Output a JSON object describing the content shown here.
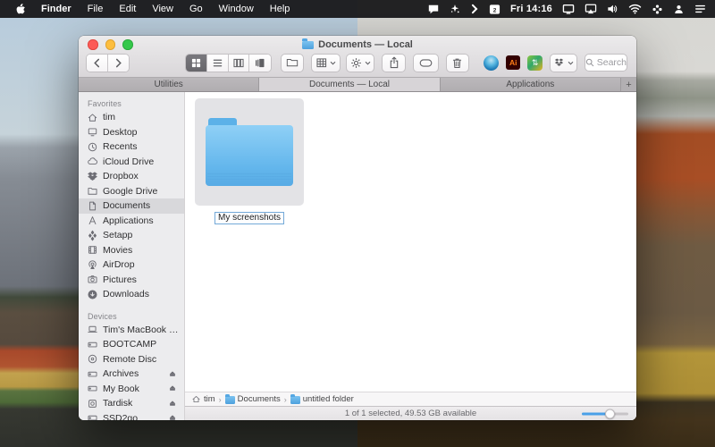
{
  "menu_bar": {
    "apple_logo": "apple",
    "items": [
      "Finder",
      "File",
      "Edit",
      "View",
      "Go",
      "Window",
      "Help"
    ],
    "clock": "Fri 14:16",
    "calendar_day": "2",
    "status_icons": [
      "chat",
      "wand",
      "chevron",
      "calendar",
      "display",
      "airplay",
      "volume",
      "wifi",
      "fan",
      "user",
      "list"
    ]
  },
  "window": {
    "title": "Documents — Local",
    "tabs": [
      {
        "label": "Utilities",
        "active": false
      },
      {
        "label": "Documents — Local",
        "active": true
      },
      {
        "label": "Applications",
        "active": false
      }
    ],
    "add_tab_label": "+",
    "search_placeholder": "Search",
    "toolbar_icons": [
      "back",
      "forward",
      "icon-view",
      "list-view",
      "column-view",
      "coverflow-view",
      "new-folder",
      "arrange-menu",
      "action-menu",
      "share",
      "tag",
      "trash",
      "app-sphere",
      "app-illustrator",
      "app-colored",
      "dropbox-menu",
      "search"
    ],
    "ai_label": "Ai"
  },
  "sidebar": {
    "sections": [
      {
        "title": "Favorites",
        "items": [
          {
            "label": "tim",
            "icon": "home"
          },
          {
            "label": "Desktop",
            "icon": "desktop"
          },
          {
            "label": "Recents",
            "icon": "clock"
          },
          {
            "label": "iCloud Drive",
            "icon": "cloud"
          },
          {
            "label": "Dropbox",
            "icon": "dropbox"
          },
          {
            "label": "Google Drive",
            "icon": "folder"
          },
          {
            "label": "Documents",
            "icon": "document",
            "selected": true
          },
          {
            "label": "Applications",
            "icon": "app-a"
          },
          {
            "label": "Setapp",
            "icon": "setapp"
          },
          {
            "label": "Movies",
            "icon": "film"
          },
          {
            "label": "AirDrop",
            "icon": "airdrop"
          },
          {
            "label": "Pictures",
            "icon": "camera"
          },
          {
            "label": "Downloads",
            "icon": "download"
          }
        ]
      },
      {
        "title": "Devices",
        "items": [
          {
            "label": "Tim's MacBook Pro",
            "icon": "laptop"
          },
          {
            "label": "BOOTCAMP",
            "icon": "hdd"
          },
          {
            "label": "Remote Disc",
            "icon": "disc"
          },
          {
            "label": "Archives",
            "icon": "hdd",
            "eject": true
          },
          {
            "label": "My Book",
            "icon": "hdd",
            "eject": true
          },
          {
            "label": "Tardisk",
            "icon": "sdcard",
            "eject": true
          },
          {
            "label": "SSD2go",
            "icon": "hdd",
            "eject": true
          }
        ]
      }
    ]
  },
  "content": {
    "folder_name": "My screenshots"
  },
  "path_bar": {
    "segments": [
      {
        "label": "tim",
        "icon": "home"
      },
      {
        "label": "Documents",
        "icon": "folder-blue"
      },
      {
        "label": "untitled folder",
        "icon": "folder-blue"
      }
    ]
  },
  "status_bar": {
    "text": "1 of 1 selected, 49.53 GB available",
    "zoom_percent": 60
  },
  "colors": {
    "accent_blue": "#4aa0e8",
    "folder_blue": "#63b6ec",
    "menu_bar_bg": "#1a1a1c",
    "selection_grey": "#d8d8db"
  }
}
